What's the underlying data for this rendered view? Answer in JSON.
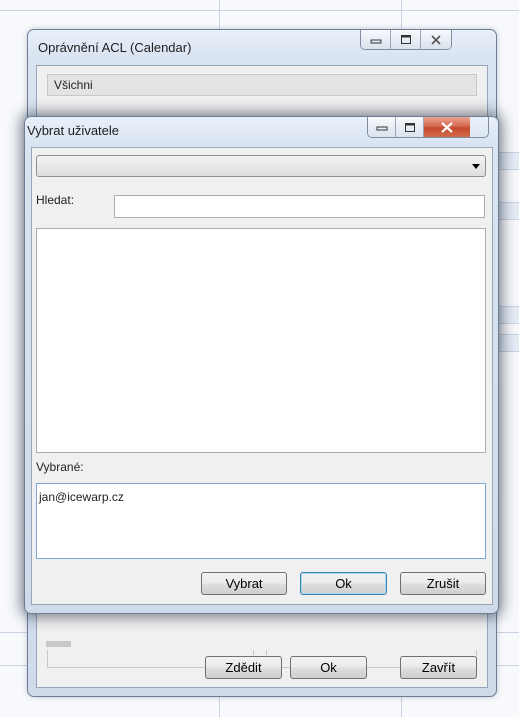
{
  "acl_window": {
    "title": "Oprávnění ACL (Calendar)",
    "list_first_item": "Všichni",
    "buttons": {
      "inherit": "Zdědit",
      "ok": "Ok",
      "close": "Zavřít"
    }
  },
  "picker_window": {
    "title": "Vybrat uživatele",
    "combo_value": "",
    "search_label": "Hledat:",
    "search_value": "",
    "selected_label": "Vybrané:",
    "selected_value": "jan@icewarp.cz",
    "buttons": {
      "select": "Vybrat",
      "ok": "Ok",
      "cancel": "Zrušit"
    }
  },
  "colors": {
    "window_frame": "#cfdbea",
    "close_button": "#c54a2c",
    "client_background": "#f0f0f0",
    "default_button_border": "#3c7fb1"
  },
  "icons": [
    "minimize-icon",
    "maximize-icon",
    "close-icon",
    "chevron-down-icon"
  ]
}
